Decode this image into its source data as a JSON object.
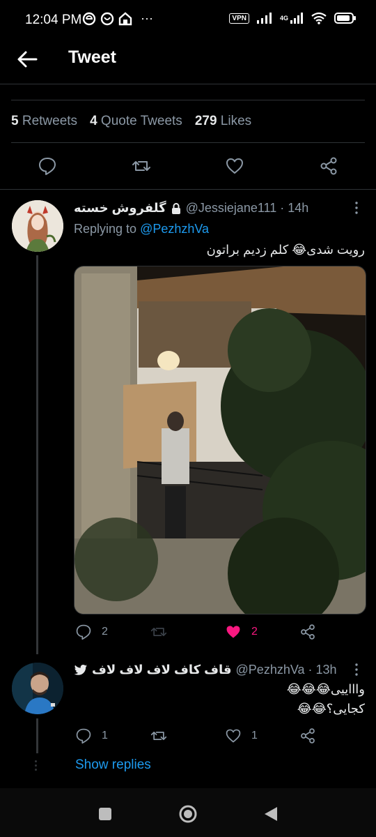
{
  "status_bar": {
    "time": "12:04 PM",
    "vpn": "VPN",
    "network": "4G",
    "dots": "···"
  },
  "header": {
    "title": "Tweet"
  },
  "stats": {
    "retweets_count": "5",
    "retweets_label": "Retweets",
    "quotes_count": "4",
    "quotes_label": "Quote Tweets",
    "likes_count": "279",
    "likes_label": "Likes"
  },
  "reply1": {
    "name": "گلفروش خسته",
    "handle": "@Jessiejane111 · 14h",
    "replying_prefix": "Replying to ",
    "replying_to": "@PezhzhVa",
    "text": "رویت شدی😂 کلم زدیم براتون",
    "reply_count": "2",
    "like_count": "2",
    "liked": true
  },
  "reply2": {
    "name": "قاف کاف لاف لاف لاف",
    "handle": "@PezhzhVa · 13h",
    "text_line1": "واااییی😂😂😂",
    "text_line2": "کجایی؟😂😂",
    "reply_count": "1",
    "like_count": "1"
  },
  "show_replies": "Show replies",
  "colors": {
    "accent": "#1d9bf0",
    "like": "#f91880",
    "muted": "#8b98a5",
    "bg": "#000000"
  }
}
